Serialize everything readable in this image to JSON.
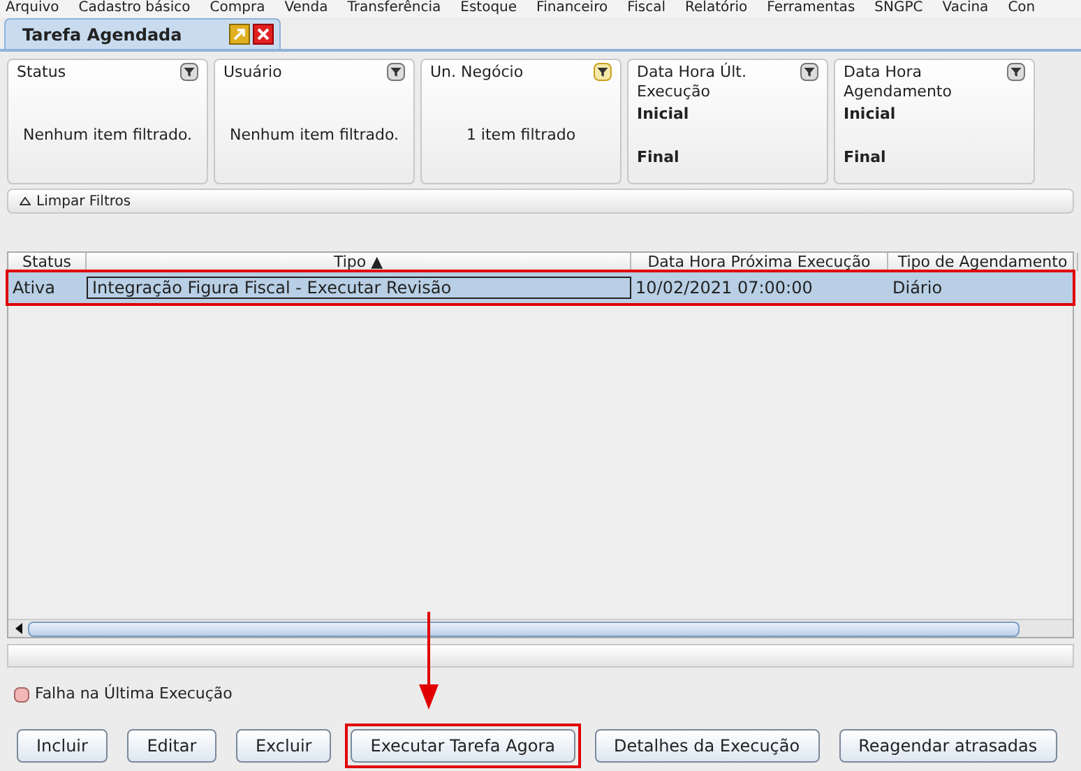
{
  "menu": [
    "Arquivo",
    "Cadastro básico",
    "Compra",
    "Venda",
    "Transferência",
    "Estoque",
    "Financeiro",
    "Fiscal",
    "Relatório",
    "Ferramentas",
    "SNGPC",
    "Vacina",
    "Con"
  ],
  "tab": {
    "title": "Tarefa Agendada",
    "selected": true
  },
  "filters": [
    {
      "kind": "list",
      "title": "Status",
      "active": false,
      "summary": "Nenhum item filtrado."
    },
    {
      "kind": "list",
      "title": "Usuário",
      "active": false,
      "summary": "Nenhum item filtrado."
    },
    {
      "kind": "list",
      "title": "Un. Negócio",
      "active": true,
      "summary": "1 item filtrado"
    },
    {
      "kind": "range",
      "title": "Data Hora Últ. Execução",
      "active": false,
      "start_label": "Inicial",
      "end_label": "Final"
    },
    {
      "kind": "range",
      "title": "Data Hora Agendamento",
      "active": false,
      "start_label": "Inicial",
      "end_label": "Final"
    }
  ],
  "clear_filters": {
    "label": "Limpar Filtros",
    "expanded": true
  },
  "table": {
    "columns": [
      "Status",
      "Tipo ▲",
      "Data Hora Próxima Execução",
      "Tipo de Agendamento"
    ],
    "rows": [
      {
        "selected": true,
        "cells": [
          "Ativa",
          "Integração Figura Fiscal - Executar Revisão",
          "10/02/2021 07:00:00",
          "Diário"
        ]
      }
    ]
  },
  "legend": {
    "label": "Falha na Última Execução",
    "color": "#f2b8b8"
  },
  "buttons": [
    {
      "label": "Incluir",
      "highlighted": false
    },
    {
      "label": "Editar",
      "highlighted": false
    },
    {
      "label": "Excluir",
      "highlighted": false
    },
    {
      "label": "Executar Tarefa Agora",
      "highlighted": true
    },
    {
      "label": "Detalhes da Execução",
      "highlighted": false
    },
    {
      "label": "Reagendar atrasadas",
      "highlighted": false
    }
  ]
}
